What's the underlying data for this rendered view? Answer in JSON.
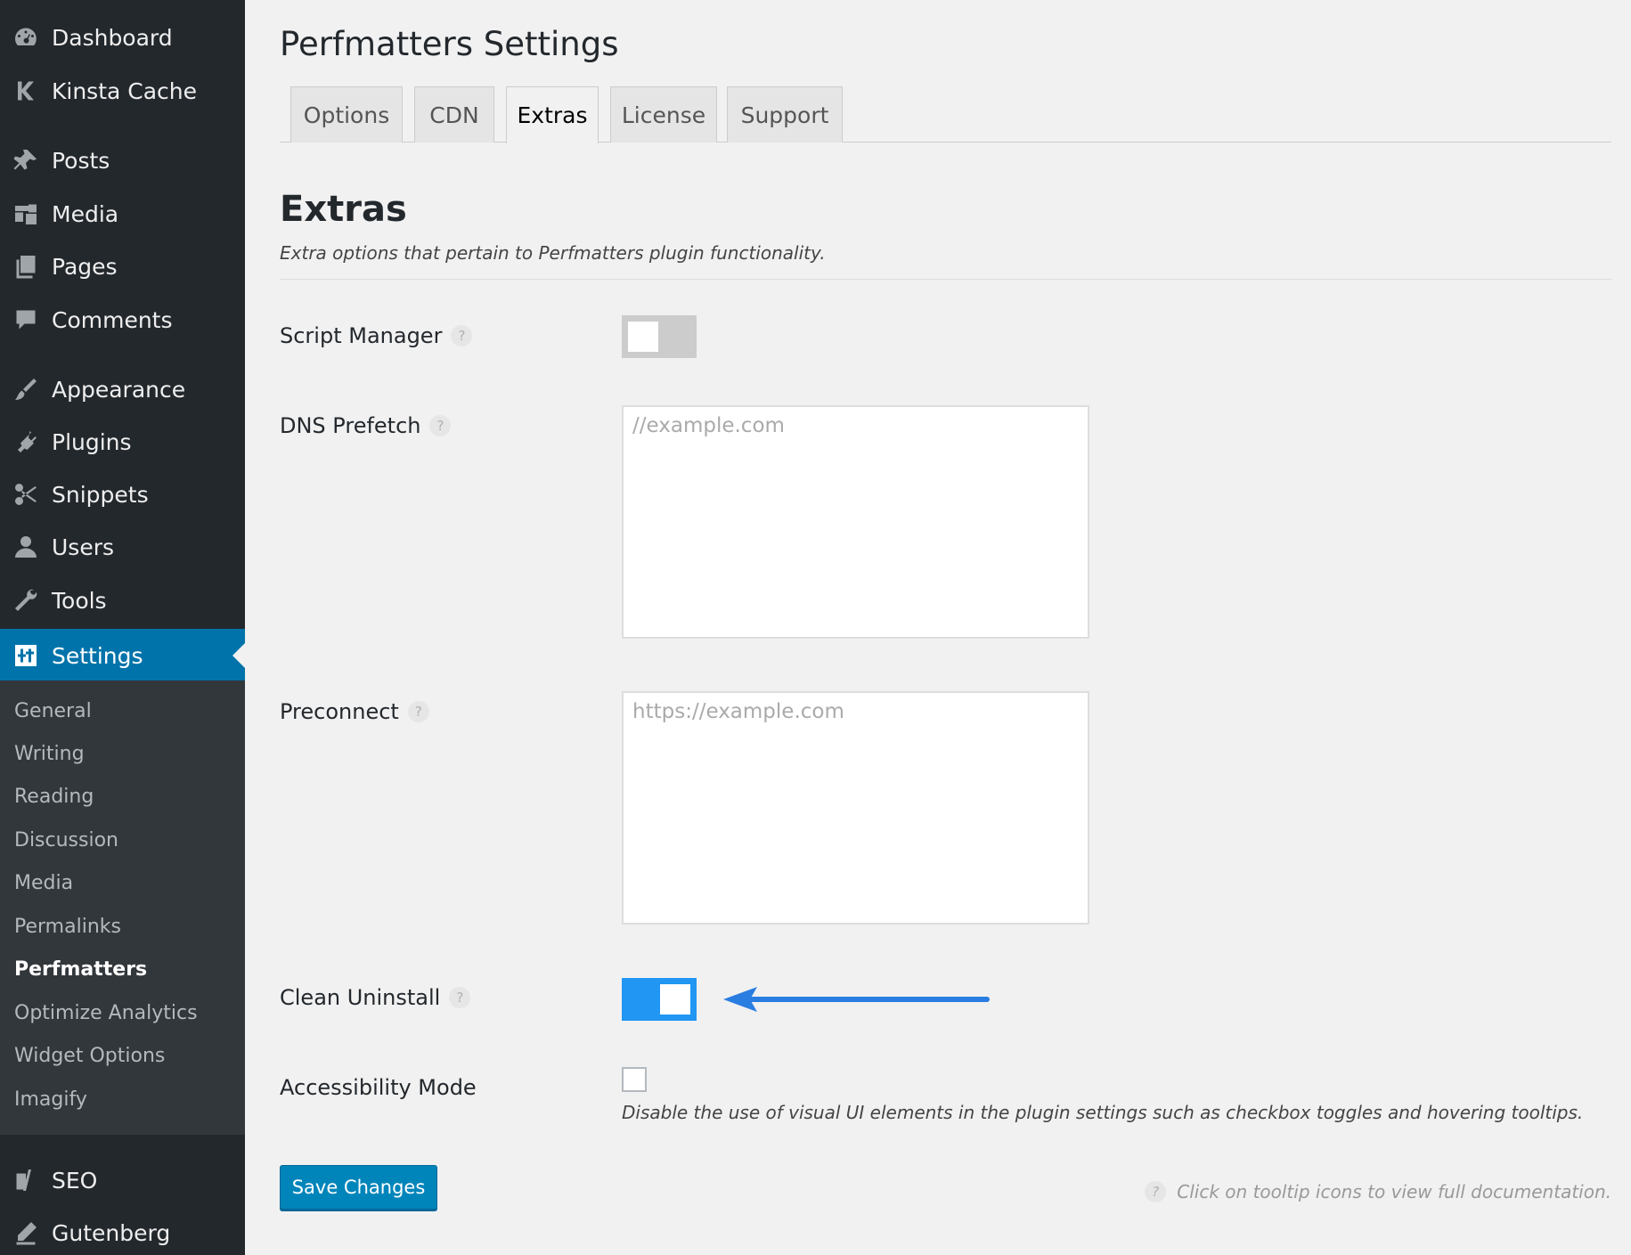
{
  "sidebar": {
    "items": [
      {
        "label": "Dashboard",
        "icon": "dashboard-icon"
      },
      {
        "label": "Kinsta Cache",
        "icon": "kinsta-icon"
      },
      {
        "label": "Posts",
        "icon": "pin-icon"
      },
      {
        "label": "Media",
        "icon": "media-icon"
      },
      {
        "label": "Pages",
        "icon": "pages-icon"
      },
      {
        "label": "Comments",
        "icon": "comment-icon"
      },
      {
        "label": "Appearance",
        "icon": "brush-icon"
      },
      {
        "label": "Plugins",
        "icon": "plugin-icon"
      },
      {
        "label": "Snippets",
        "icon": "scissors-icon"
      },
      {
        "label": "Users",
        "icon": "user-icon"
      },
      {
        "label": "Tools",
        "icon": "wrench-icon"
      },
      {
        "label": "Settings",
        "icon": "settings-icon"
      },
      {
        "label": "SEO",
        "icon": "yoast-icon"
      },
      {
        "label": "Gutenberg",
        "icon": "pencil-icon"
      }
    ],
    "submenu": [
      "General",
      "Writing",
      "Reading",
      "Discussion",
      "Media",
      "Permalinks",
      "Perfmatters",
      "Optimize Analytics",
      "Widget Options",
      "Imagify"
    ],
    "submenu_current": "Perfmatters",
    "active_color": "#0073aa"
  },
  "page": {
    "title": "Perfmatters Settings",
    "tabs": [
      "Options",
      "CDN",
      "Extras",
      "License",
      "Support"
    ],
    "active_tab": "Extras"
  },
  "section": {
    "title": "Extras",
    "description": "Extra options that pertain to Perfmatters plugin functionality."
  },
  "fields": {
    "script_manager": {
      "label": "Script Manager",
      "enabled": false
    },
    "dns_prefetch": {
      "label": "DNS Prefetch",
      "value": "",
      "placeholder": "//example.com"
    },
    "preconnect": {
      "label": "Preconnect",
      "value": "",
      "placeholder": "https://example.com"
    },
    "clean_uninstall": {
      "label": "Clean Uninstall",
      "enabled": true
    },
    "accessibility_mode": {
      "label": "Accessibility Mode",
      "checked": false,
      "description": "Disable the use of visual UI elements in the plugin settings such as checkbox toggles and hovering tooltips."
    }
  },
  "help_glyph": "?",
  "save_label": "Save Changes",
  "footer_note": "Click on tooltip icons to view full documentation.",
  "colors": {
    "toggle_on": "#2196f3",
    "toggle_off": "#cccccc",
    "button": "#0085ba",
    "arrow": "#2a7de1"
  }
}
